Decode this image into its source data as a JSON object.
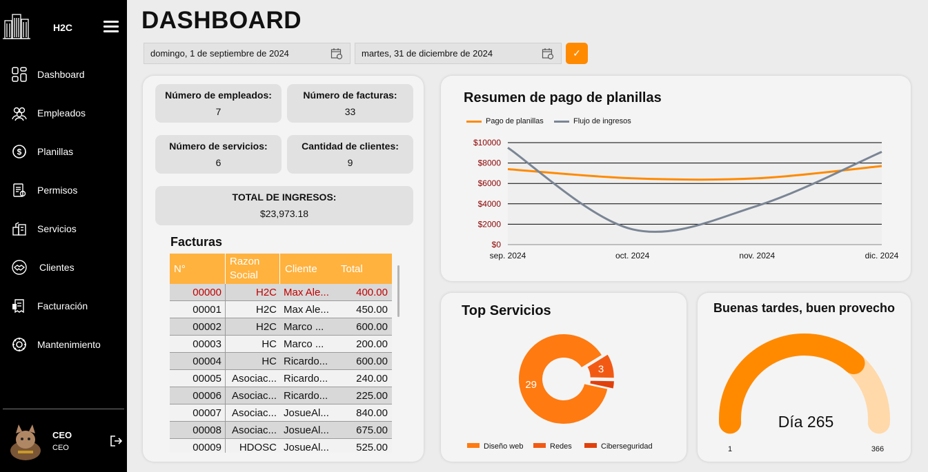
{
  "app": {
    "name": "H2C"
  },
  "nav": [
    {
      "label": "Dashboard",
      "icon": "dashboard-icon"
    },
    {
      "label": "Empleados",
      "icon": "employees-icon"
    },
    {
      "label": "Planillas",
      "icon": "payroll-icon"
    },
    {
      "label": "Permisos",
      "icon": "permissions-icon"
    },
    {
      "label": "Servicios",
      "icon": "services-icon"
    },
    {
      "label": "Clientes",
      "icon": "handshake-icon"
    },
    {
      "label": "Facturación",
      "icon": "invoice-icon"
    },
    {
      "label": "Mantenimiento",
      "icon": "maintenance-icon"
    }
  ],
  "user": {
    "role": "CEO",
    "subtitle": "CEO"
  },
  "header": {
    "title": "DASHBOARD",
    "date_from": "domingo, 1 de septiembre de 2024",
    "date_to": "martes, 31 de diciembre de 2024",
    "apply_label": "✓"
  },
  "stats": {
    "employees": {
      "label": "Número de empleados:",
      "value": "7"
    },
    "invoices": {
      "label": "Número de facturas:",
      "value": "33"
    },
    "services": {
      "label": "Número de servicios:",
      "value": "6"
    },
    "clients": {
      "label": "Cantidad de clientes:",
      "value": "9"
    },
    "income": {
      "label": "TOTAL DE INGRESOS:",
      "value": "$23,973.18"
    }
  },
  "facturas": {
    "title": "Facturas",
    "columns": [
      "N°",
      "Razon Social",
      "Cliente",
      "Total"
    ],
    "rows": [
      [
        "00000",
        "H2C",
        "Max Ale...",
        "400.00"
      ],
      [
        "00001",
        "H2C",
        "Max Ale...",
        "450.00"
      ],
      [
        "00002",
        "H2C",
        "Marco ...",
        "600.00"
      ],
      [
        "00003",
        "HC",
        "Marco ...",
        "200.00"
      ],
      [
        "00004",
        "HC",
        "Ricardo...",
        "600.00"
      ],
      [
        "00005",
        "Asociac...",
        "Ricardo...",
        "240.00"
      ],
      [
        "00006",
        "Asociac...",
        "Ricardo...",
        "225.00"
      ],
      [
        "00007",
        "Asociac...",
        "JosueAl...",
        "840.00"
      ],
      [
        "00008",
        "Asociac...",
        "JosueAl...",
        "675.00"
      ],
      [
        "00009",
        "HDOSC",
        "JosueAl...",
        "525.00"
      ]
    ]
  },
  "chart_data": [
    {
      "type": "line",
      "title": "Resumen de pago de planillas",
      "x": [
        "sep. 2024",
        "oct. 2024",
        "nov. 2024",
        "dic. 2024"
      ],
      "ylim": [
        0,
        10000
      ],
      "yticks": [
        "$0",
        "$2000",
        "$4000",
        "$6000",
        "$8000",
        "$10000"
      ],
      "grid": true,
      "legend_position": "top-left",
      "series": [
        {
          "name": "Pago de planillas",
          "values": [
            7400,
            6500,
            6500,
            7700
          ],
          "color": "#ff8a00"
        },
        {
          "name": "Flujo de ingresos",
          "values": [
            9500,
            1500,
            3800,
            9100
          ],
          "color": "#7a8594"
        }
      ]
    },
    {
      "type": "pie",
      "title": "Top Servicios",
      "categories": [
        "Diseño web",
        "Redes",
        "Ciberseguridad"
      ],
      "values": [
        29,
        3,
        1
      ],
      "labels": [
        "29",
        "3",
        ""
      ],
      "colors": [
        "#ff7a10",
        "#f25a14",
        "#e0400b"
      ],
      "legend_position": "bottom"
    }
  ],
  "gauge": {
    "title": "Buenas tardes, buen provecho",
    "label": "Día 265",
    "value": 265,
    "min_label": "1",
    "max_label": "366",
    "min": 1,
    "max": 366,
    "color": "#ff8a00",
    "track_color": "#ffd9aa"
  }
}
